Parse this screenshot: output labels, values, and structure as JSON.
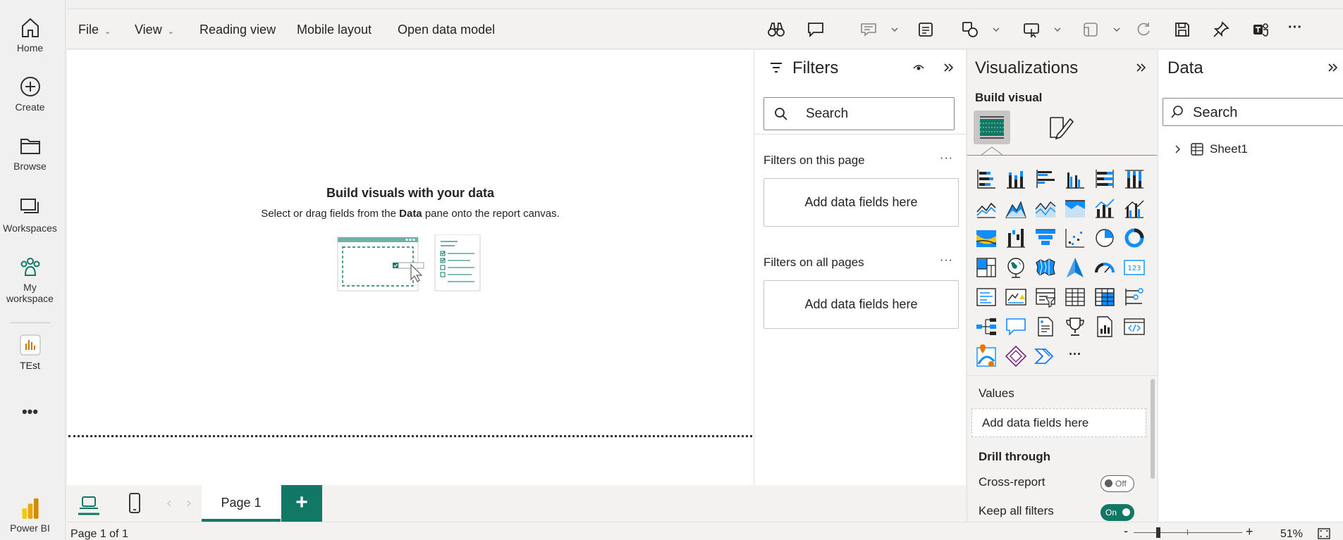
{
  "rail": {
    "items": [
      {
        "label": "Home",
        "icon": "home-icon"
      },
      {
        "label": "Create",
        "icon": "create-plus-icon"
      },
      {
        "label": "Browse",
        "icon": "folder-icon"
      },
      {
        "label": "Workspaces",
        "icon": "workspaces-icon"
      },
      {
        "label": "My",
        "label2": "workspace",
        "icon": "people-icon"
      },
      {
        "label": "TEst",
        "icon": "report-icon"
      }
    ],
    "more": "•••",
    "brand": "Power BI"
  },
  "menu": {
    "file": "File",
    "view": "View",
    "reading_view": "Reading view",
    "mobile_layout": "Mobile layout",
    "open_data_model": "Open data model",
    "more": "···"
  },
  "canvas": {
    "empty_title": "Build visuals with your data",
    "empty_sub_before": "Select or drag fields from the ",
    "empty_sub_bold": "Data",
    "empty_sub_after": " pane onto the report canvas."
  },
  "pages": {
    "tab_label": "Page 1",
    "add_label": "+",
    "status": "Page 1 of 1"
  },
  "zoom": {
    "minus": "-",
    "plus": "+",
    "level": "51%",
    "level_value": 51
  },
  "filters": {
    "title": "Filters",
    "search_placeholder": "Search",
    "on_this_page": "Filters on this page",
    "on_all_pages": "Filters on all pages",
    "add_fields_1": "Add data fields here",
    "add_fields_2": "Add data fields here",
    "more": "···"
  },
  "visualizations": {
    "title": "Visualizations",
    "build_visual": "Build visual",
    "more_visuals": "···",
    "values_label": "Values",
    "values_add": "Add data fields here",
    "drill_through": "Drill through",
    "cross_report": "Cross-report",
    "cross_report_state": "Off",
    "keep_all_filters": "Keep all filters",
    "keep_all_filters_state": "On"
  },
  "data": {
    "title": "Data",
    "search_placeholder": "Search",
    "tables": [
      "Sheet1"
    ]
  },
  "colors": {
    "accent": "#117865",
    "viz_blue": "#118dff",
    "dark_icon": "#252423"
  }
}
